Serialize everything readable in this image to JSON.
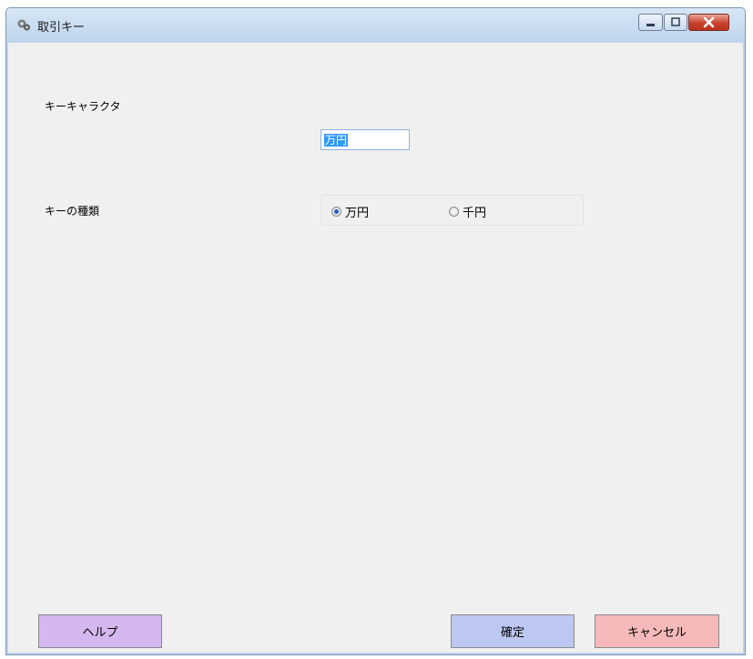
{
  "window": {
    "title": "取引キー",
    "icon": "gears-icon",
    "controls": {
      "minimize": "minimize-icon",
      "maximize": "maximize-icon",
      "close": "close-icon"
    }
  },
  "form": {
    "key_character_label": "キーキャラクタ",
    "key_character_value": "万円",
    "key_type_label": "キーの種類",
    "key_type_options": [
      "万円",
      "千円"
    ],
    "key_type_selected": "万円"
  },
  "buttons": {
    "help": "ヘルプ",
    "ok": "確定",
    "cancel": "キャンセル"
  },
  "colors": {
    "help_button": "#d3b7ee",
    "ok_button": "#bcc8f2",
    "cancel_button": "#f6b9b9",
    "selection": "#3399ff"
  }
}
